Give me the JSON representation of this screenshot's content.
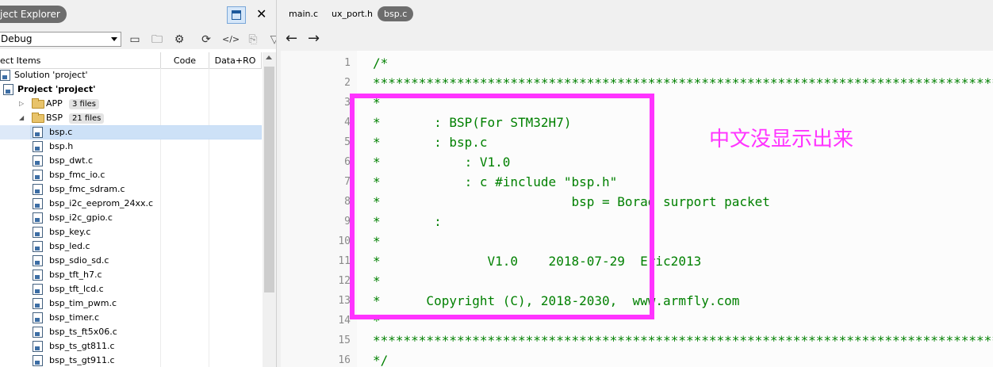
{
  "project_explorer": {
    "title": "ject Explorer",
    "configuration": "Debug",
    "columns": {
      "items": "ect Items",
      "code": "Code",
      "data": "Data+RO"
    },
    "tree": [
      {
        "label": "Solution 'project'",
        "indent": 0,
        "type": "solution"
      },
      {
        "label": "Project 'project'",
        "indent": 1,
        "type": "project",
        "bold": true
      },
      {
        "label": "APP",
        "indent": 2,
        "type": "folder",
        "badge": "3 files",
        "expander": "▷"
      },
      {
        "label": "BSP",
        "indent": 2,
        "type": "folder",
        "badge": "21 files",
        "expander": "◢"
      },
      {
        "label": "bsp.c",
        "indent": 3,
        "type": "file",
        "selected": true
      },
      {
        "label": "bsp.h",
        "indent": 3,
        "type": "file"
      },
      {
        "label": "bsp_dwt.c",
        "indent": 3,
        "type": "file"
      },
      {
        "label": "bsp_fmc_io.c",
        "indent": 3,
        "type": "file"
      },
      {
        "label": "bsp_fmc_sdram.c",
        "indent": 3,
        "type": "file"
      },
      {
        "label": "bsp_i2c_eeprom_24xx.c",
        "indent": 3,
        "type": "file"
      },
      {
        "label": "bsp_i2c_gpio.c",
        "indent": 3,
        "type": "file"
      },
      {
        "label": "bsp_key.c",
        "indent": 3,
        "type": "file"
      },
      {
        "label": "bsp_led.c",
        "indent": 3,
        "type": "file"
      },
      {
        "label": "bsp_sdio_sd.c",
        "indent": 3,
        "type": "file"
      },
      {
        "label": "bsp_tft_h7.c",
        "indent": 3,
        "type": "file"
      },
      {
        "label": "bsp_tft_lcd.c",
        "indent": 3,
        "type": "file"
      },
      {
        "label": "bsp_tim_pwm.c",
        "indent": 3,
        "type": "file"
      },
      {
        "label": "bsp_timer.c",
        "indent": 3,
        "type": "file"
      },
      {
        "label": "bsp_ts_ft5x06.c",
        "indent": 3,
        "type": "file"
      },
      {
        "label": "bsp_ts_gt811.c",
        "indent": 3,
        "type": "file"
      },
      {
        "label": "bsp_ts_gt911.c",
        "indent": 3,
        "type": "file"
      }
    ]
  },
  "editor": {
    "tabs": [
      {
        "label": "main.c",
        "active": false
      },
      {
        "label": "ux_port.h",
        "active": false
      },
      {
        "label": "bsp.c",
        "active": true
      }
    ],
    "lines": [
      {
        "n": "1",
        "text": "/*"
      },
      {
        "n": "2",
        "text": "*****************************************************************************************"
      },
      {
        "n": "3",
        "text": "*"
      },
      {
        "n": "4",
        "text": "*       : BSP(For STM32H7)"
      },
      {
        "n": "5",
        "text": "*       : bsp.c"
      },
      {
        "n": "6",
        "text": "*           : V1.0"
      },
      {
        "n": "7",
        "text": "*           : c #include \"bsp.h\""
      },
      {
        "n": "8",
        "text": "*                         bsp = Borad surport packet"
      },
      {
        "n": "9",
        "text": "*       :"
      },
      {
        "n": "10",
        "text": "*"
      },
      {
        "n": "11",
        "text": "*              V1.0    2018-07-29  Eric2013"
      },
      {
        "n": "12",
        "text": "*"
      },
      {
        "n": "13",
        "text": "*      Copyright (C), 2018-2030,  www.armfly.com"
      },
      {
        "n": "14",
        "text": "*"
      },
      {
        "n": "15",
        "text": "*****************************************************************************************"
      },
      {
        "n": "16",
        "text": "*/"
      }
    ]
  },
  "annotation": {
    "text": "中文没显示出来",
    "color": "#ff33ff"
  }
}
